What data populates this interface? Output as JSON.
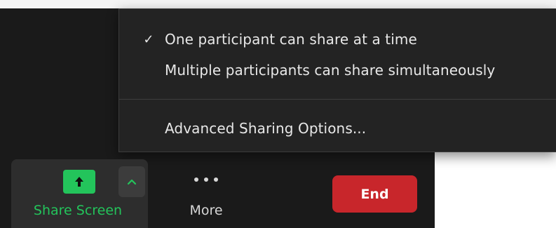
{
  "share_menu": {
    "items": [
      {
        "label": "One participant can share at a time",
        "checked": true,
        "check_glyph": "✓"
      },
      {
        "label": "Multiple participants can share simultaneously",
        "checked": false,
        "check_glyph": ""
      },
      {
        "label": "Advanced Sharing Options...",
        "checked": false,
        "check_glyph": ""
      }
    ]
  },
  "toolbar": {
    "share_screen": {
      "label": "Share Screen",
      "icon": "arrow-up-icon",
      "caret_icon": "chevron-up-icon",
      "color": "#23c45b"
    },
    "more": {
      "label": "More",
      "icon": "ellipsis-icon"
    },
    "end": {
      "label": "End",
      "color": "#c8262b"
    }
  },
  "colors": {
    "menu_background": "#232323",
    "toolbar_background": "#1a1a1a",
    "accent_green": "#23c45b"
  }
}
